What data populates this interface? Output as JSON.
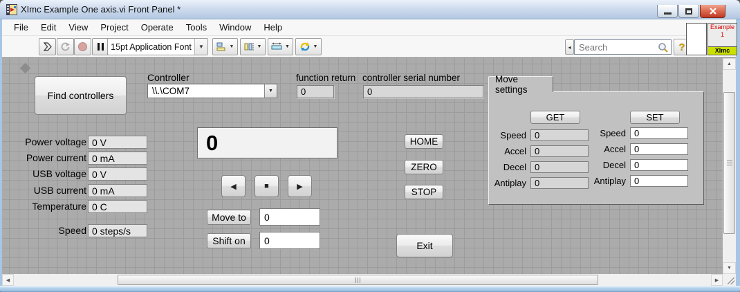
{
  "window": {
    "title": "XImc Example One axis.vi Front Panel *"
  },
  "menu": {
    "items": [
      "File",
      "Edit",
      "View",
      "Project",
      "Operate",
      "Tools",
      "Window",
      "Help"
    ]
  },
  "toolbar": {
    "font_selector": "15pt Application Font",
    "search_placeholder": "Search"
  },
  "vi_icon": {
    "line1": "Example",
    "line2": "1",
    "badge": "XImc"
  },
  "colors": {
    "panel_gray": "#ababab",
    "titlebar_blue": "#cfdcee",
    "close_red": "#bf3a25",
    "vi_badge_green": "#cbe000",
    "vi_text_red": "#e00000"
  },
  "panel": {
    "find_controllers_button": "Find controllers",
    "controller": {
      "label": "Controller",
      "value": "\\\\.\\COM7"
    },
    "function_return": {
      "label": "function return",
      "value": "0"
    },
    "serial_number": {
      "label": "controller serial number",
      "value": "0"
    },
    "telemetry": [
      {
        "label": "Power voltage",
        "value": "0 V"
      },
      {
        "label": "Power current",
        "value": "0 mA"
      },
      {
        "label": "USB voltage",
        "value": "0 V"
      },
      {
        "label": "USB current",
        "value": "0 mA"
      },
      {
        "label": "Temperature",
        "value": "0 C"
      },
      {
        "label": "Speed",
        "value": "0 steps/s"
      }
    ],
    "position_display": "0",
    "jog": {
      "left_icon": "◀",
      "stop_icon": "■",
      "right_icon": "▶"
    },
    "move_to": {
      "button": "Move to",
      "value": "0"
    },
    "shift_on": {
      "button": "Shift on",
      "value": "0"
    },
    "home_button": "HOME",
    "zero_button": "ZERO",
    "stop_button": "STOP",
    "exit_button": "Exit",
    "move_settings": {
      "tab_label": "Move settings",
      "get": {
        "button": "GET",
        "rows": [
          {
            "label": "Speed",
            "value": "0"
          },
          {
            "label": "Accel",
            "value": "0"
          },
          {
            "label": "Decel",
            "value": "0"
          },
          {
            "label": "Antiplay",
            "value": "0"
          }
        ]
      },
      "set": {
        "button": "SET",
        "rows": [
          {
            "label": "Speed",
            "value": "0"
          },
          {
            "label": "Accel",
            "value": "0"
          },
          {
            "label": "Decel",
            "value": "0"
          },
          {
            "label": "Antiplay",
            "value": "0"
          }
        ]
      }
    }
  }
}
